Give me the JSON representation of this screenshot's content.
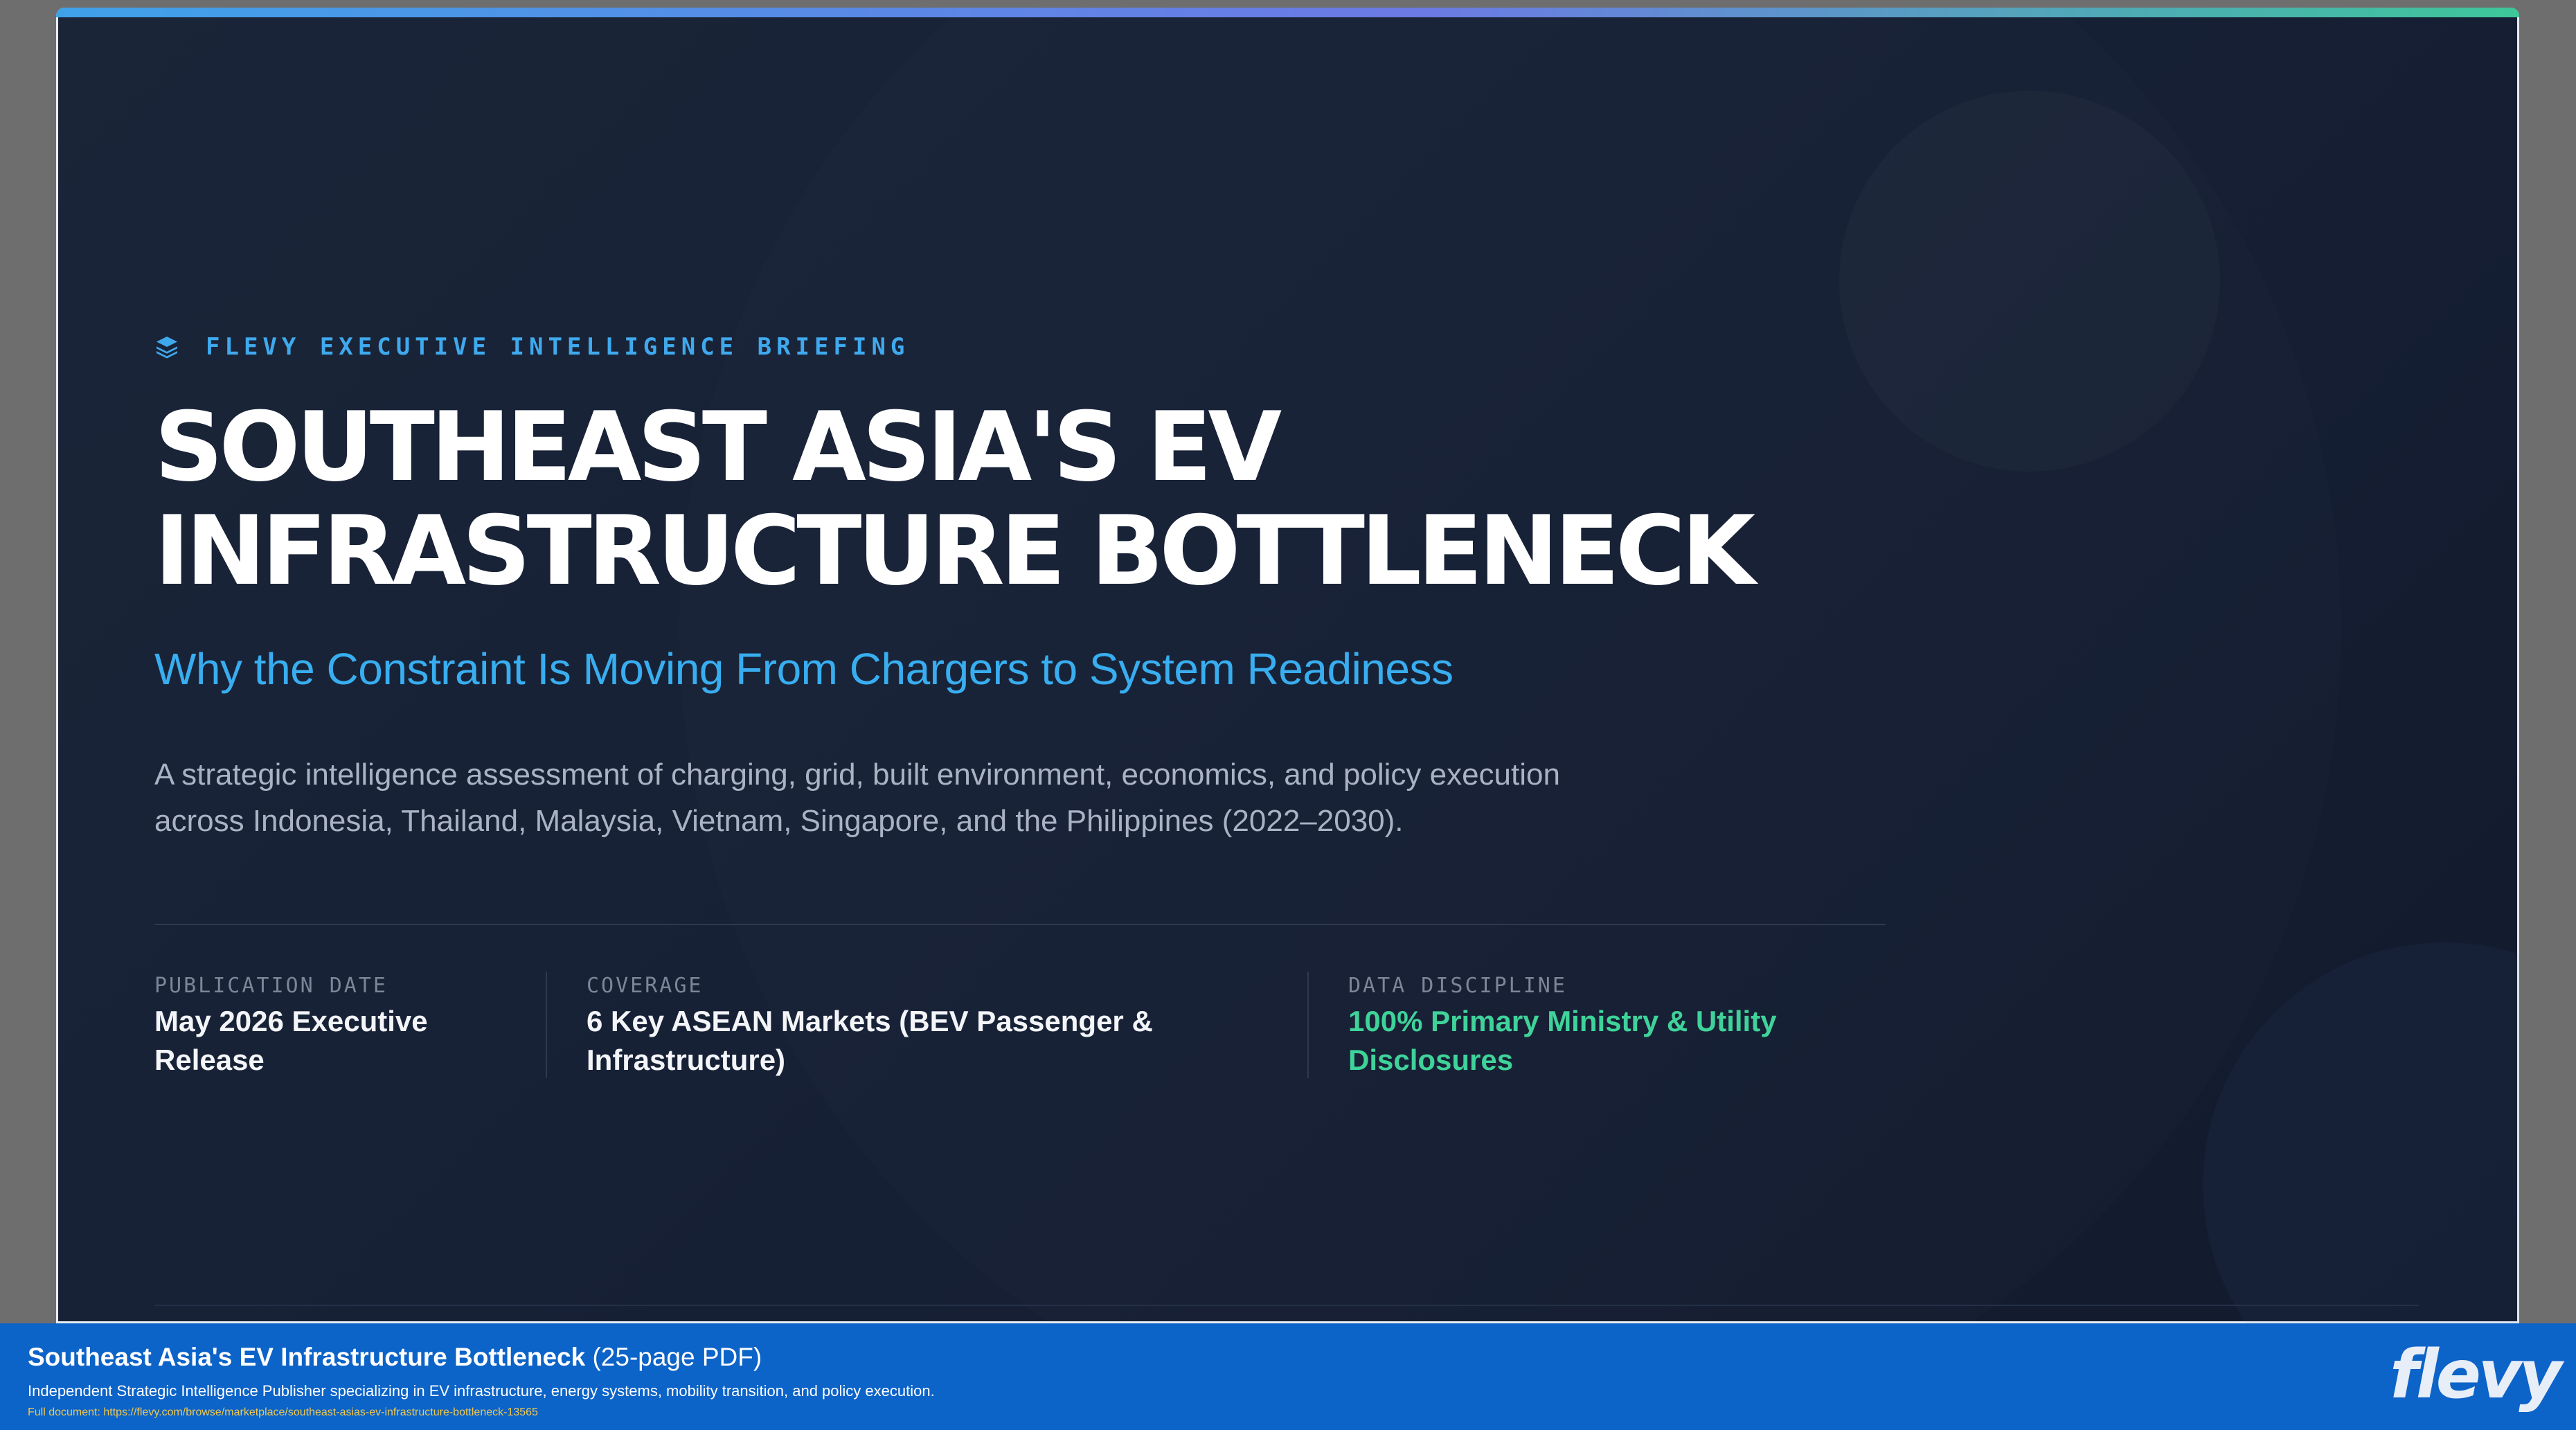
{
  "slide": {
    "eyebrow": "FLEVY EXECUTIVE INTELLIGENCE BRIEFING",
    "eyebrow_icon": "layers-icon",
    "title_line1": "SOUTHEAST ASIA'S EV",
    "title_line2": "INFRASTRUCTURE BOTTLENECK",
    "subtitle": "Why the Constraint Is Moving From Chargers to System Readiness",
    "description_line1": "A strategic intelligence assessment of charging, grid, built environment, economics, and policy execution",
    "description_line2": "across Indonesia, Thailand, Malaysia, Vietnam, Singapore, and the Philippines (2022–2030).",
    "meta": [
      {
        "label": "PUBLICATION DATE",
        "value_line1": "May 2026 Executive",
        "value_line2": "Release"
      },
      {
        "label": "COVERAGE",
        "value_line1": "6 Key ASEAN Markets (BEV Passenger &",
        "value_line2": "Infrastructure)"
      },
      {
        "label": "DATA DISCIPLINE",
        "value_line1": "100% Primary Ministry & Utility",
        "value_line2": "Disclosures"
      }
    ]
  },
  "footer": {
    "title": "Southeast Asia's EV Infrastructure Bottleneck",
    "title_suffix": " (25-page PDF)",
    "tagline": "Independent Strategic Intelligence Publisher specializing in EV infrastructure, energy systems, mobility transition, and policy execution.",
    "link_label": "Full document: ",
    "link_url": "https://flevy.com/browse/marketplace/southeast-asias-ev-infrastructure-bottleneck-13565",
    "logo": "flevy"
  },
  "colors": {
    "accent_blue": "#38aef0",
    "accent_green": "#3fd39a",
    "footer_blue": "#0c63c8",
    "background": "#172136"
  }
}
